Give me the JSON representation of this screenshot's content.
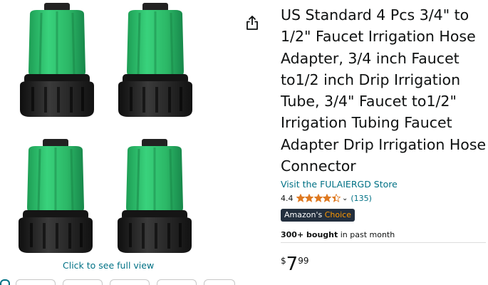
{
  "product": {
    "title": "US Standard 4 Pcs 3/4\" to 1/2\" Faucet Irrigation Hose Adapter, 3/4 inch Faucet to1/2 inch Drip Irrigation Tube, 3/4\" Faucet to1/2\" Irrigation Tubing Faucet Adapter Drip Irrigation Hose Connector",
    "store_link": "Visit the FULAIERGD Store",
    "rating": {
      "value": "4.4",
      "stars": 4.4,
      "count": "(135)"
    },
    "badge": {
      "prefix": "Amazon's",
      "choice": "Choice"
    },
    "bought": {
      "bold": "300+ bought",
      "rest": " in past month"
    },
    "price": {
      "symbol": "$",
      "whole": "7",
      "fraction": "99"
    }
  },
  "gallery": {
    "see_full_view": "Click to see full view",
    "images": [
      "green-black-adapter",
      "green-black-adapter",
      "green-black-adapter",
      "green-black-adapter"
    ]
  },
  "icons": {
    "share": "share-icon",
    "star": "star-icon",
    "chevron": "chevron-down-icon"
  },
  "colors": {
    "link": "#007185",
    "star": "#de7921",
    "badge_bg": "#232f3e",
    "adapter_green": "#2fbf6c",
    "adapter_black": "#1c1c1c"
  }
}
